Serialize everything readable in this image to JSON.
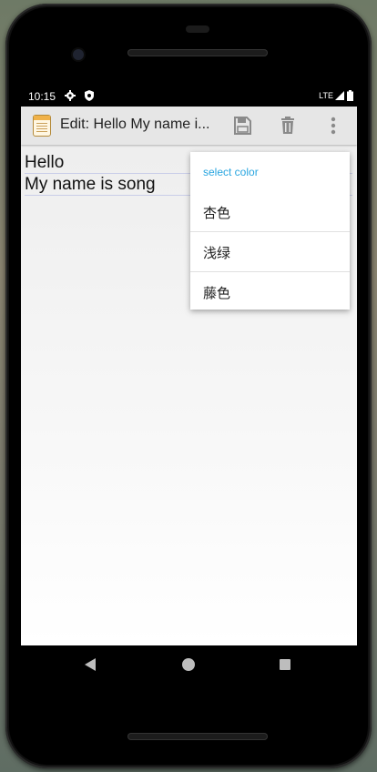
{
  "status_bar": {
    "time": "10:15",
    "network": "LTE",
    "icons": [
      "settings-gear-icon",
      "shield-icon",
      "signal-icon",
      "battery-icon"
    ]
  },
  "app_bar": {
    "title": "Edit: Hello My name i...",
    "app_icon": "notepad-icon",
    "actions": [
      "save-icon",
      "delete-icon",
      "overflow-menu-icon"
    ]
  },
  "editor": {
    "lines": [
      "Hello",
      "My name is song"
    ]
  },
  "color_menu": {
    "title": "select color",
    "items": [
      "杏色",
      "浅绿",
      "藤色"
    ]
  },
  "nav_bar": {
    "buttons": [
      "back-icon",
      "home-icon",
      "recent-apps-icon"
    ]
  },
  "colors": {
    "accent": "#2aa6e0",
    "appbar": "#e6e6e6",
    "text": "#222222"
  }
}
